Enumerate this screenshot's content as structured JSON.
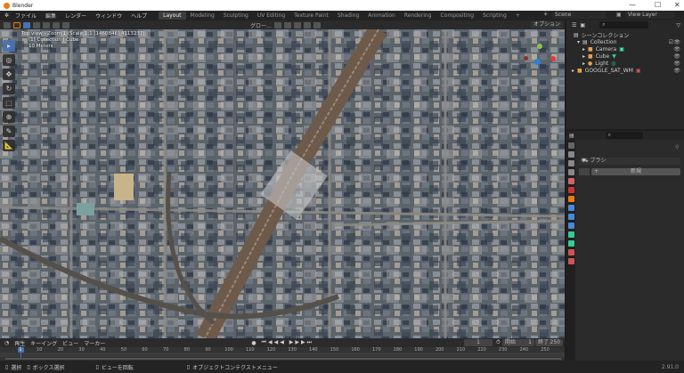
{
  "window": {
    "title": "Blender",
    "controls": [
      "—",
      "☐",
      "✕"
    ]
  },
  "menu": {
    "items": [
      "ファイル",
      "編集",
      "レンダー",
      "ウィンドウ",
      "ヘルプ"
    ],
    "workspaces": [
      "Layout",
      "Modeling",
      "Sculpting",
      "UV Editing",
      "Texture Paint",
      "Shading",
      "Animation",
      "Rendering",
      "Compositing",
      "Scripting"
    ],
    "add_tab": "+",
    "scene": "Scene",
    "view_layer": "View Layer"
  },
  "viewport_header": {
    "orientation": "グロー...",
    "options": "オプション"
  },
  "viewport_overlay": {
    "line1": "Top view - Zoom 1 (Scale 1:1 [1460846] 4113237)",
    "line2": "(1) Collection | Cube",
    "line3": "10 Meters"
  },
  "outliner": {
    "root": "シーンコレクション",
    "items": [
      {
        "label": "Collection",
        "depth": 0
      },
      {
        "label": "Camera",
        "depth": 1,
        "color": "#e8a04a"
      },
      {
        "label": "Cube",
        "depth": 1,
        "color": "#e8a04a"
      },
      {
        "label": "Light",
        "depth": 1,
        "color": "#e8a04a"
      },
      {
        "label": "GOOGLE_SAT_WM",
        "depth": 0,
        "color": "#e8a04a"
      }
    ]
  },
  "properties": {
    "brush_label": "ブラシ",
    "new_button": "新規",
    "add": "+"
  },
  "timeline": {
    "menus": [
      "再生",
      "キーイング",
      "ビュー",
      "マーカー"
    ],
    "current_frame": "1",
    "start_label": "開始",
    "start": "1",
    "end_label": "終了",
    "end": "250",
    "ticks": [
      "1",
      "10",
      "20",
      "30",
      "40",
      "50",
      "60",
      "70",
      "80",
      "90",
      "100",
      "110",
      "120",
      "130",
      "140",
      "150",
      "160",
      "170",
      "180",
      "190",
      "200",
      "210",
      "220",
      "230",
      "240",
      "250"
    ]
  },
  "statusbar": {
    "select": "選択",
    "box_select": "ボックス選択",
    "rotate_view": "ビューを回転",
    "context_menu": "オブジェクトコンテクストメニュー",
    "version": "2.91.0"
  },
  "colors": {
    "accent": "#4772b3",
    "orange": "#e87d0d"
  }
}
